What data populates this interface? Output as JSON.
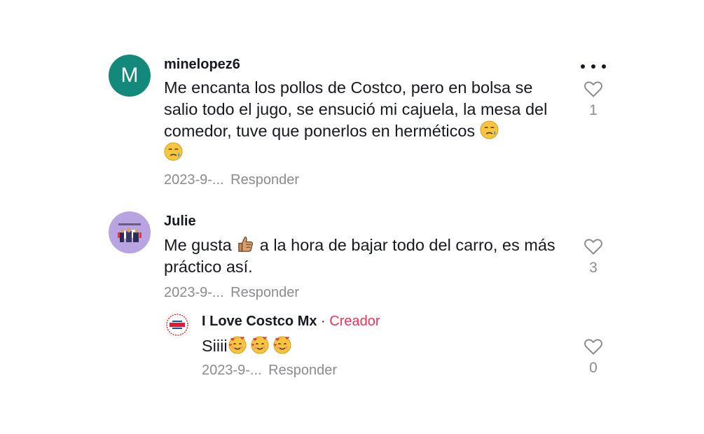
{
  "comments": [
    {
      "avatar_letter": "M",
      "avatar_color": "#13897b",
      "username": "minelopez6",
      "text_1": "Me encanta los pollos de Costco, pero en bolsa se salio todo el jugo, se ensució mi cajuela, la mesa del comedor, tuve que ponerlos en herméticos ",
      "date": "2023-9-...",
      "reply_label": "Responder",
      "like_count": "1"
    },
    {
      "avatar_color": "#b7a4e0",
      "username": "Julie",
      "text_1": "Me gusta ",
      "text_2": " a la hora de bajar todo del carro, es más práctico así.",
      "date": "2023-9-...",
      "reply_label": "Responder",
      "like_count": "3"
    }
  ],
  "reply": {
    "username": "I Love Costco Mx",
    "separator": "·",
    "creator_label": "Creador",
    "text": "Siiii",
    "date": "2023-9-...",
    "reply_label": "Responder",
    "like_count": "0"
  },
  "icons": {
    "more": "more-options-icon",
    "like": "heart-outline-icon",
    "emoji_sad": "sad-tear-emoji",
    "emoji_thumb": "thumbs-up-emoji",
    "emoji_hearts": "smiling-face-with-hearts-emoji"
  },
  "colors": {
    "accent_creator": "#fe2c55",
    "meta_grey": "#8a8b91"
  }
}
